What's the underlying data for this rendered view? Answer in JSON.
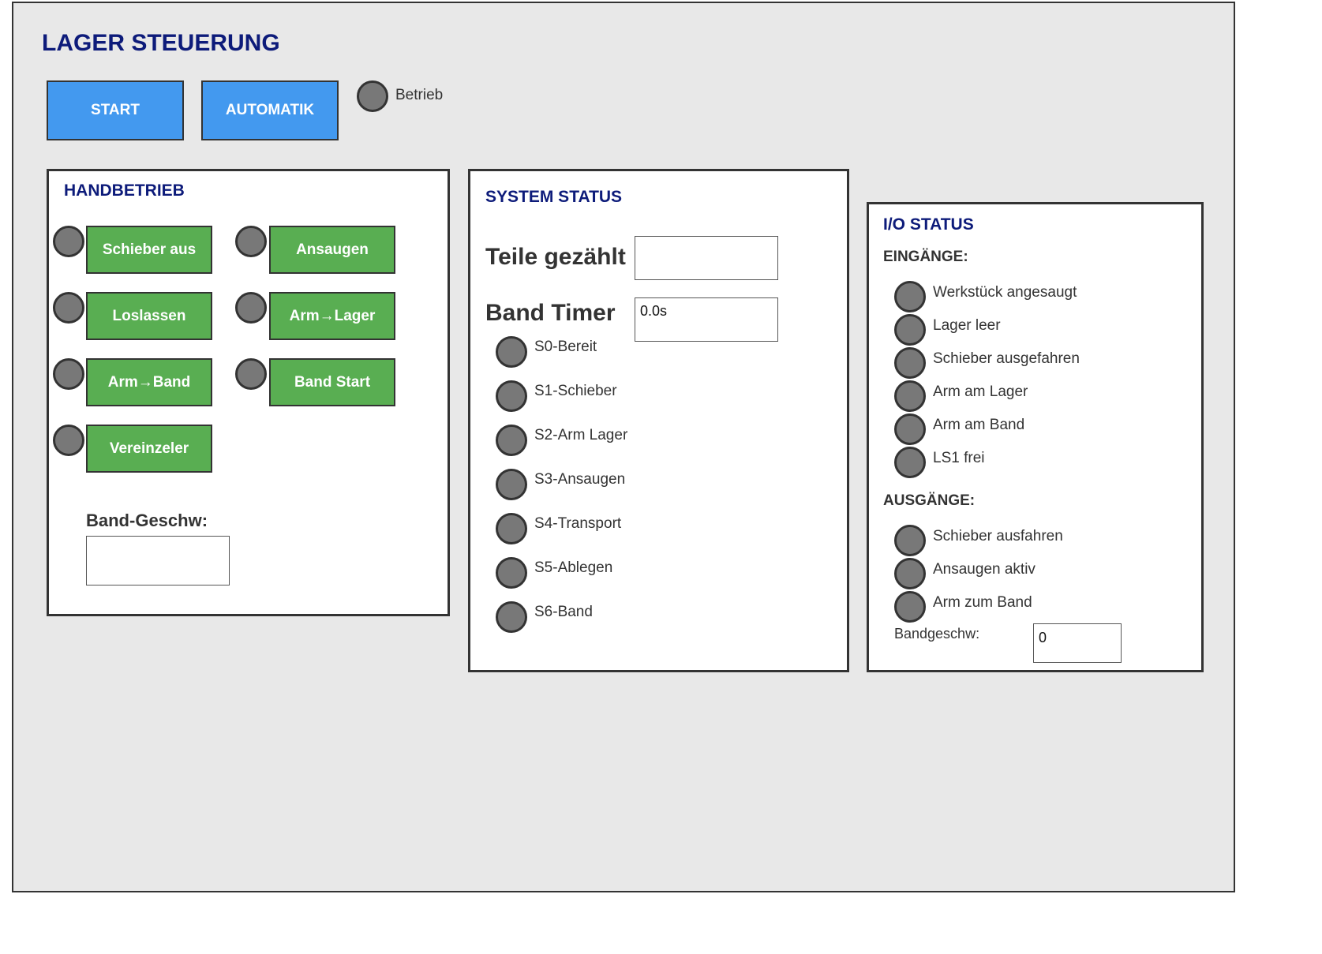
{
  "header": {
    "title": "LAGER STEUERUNG"
  },
  "controls": {
    "start_label": "START",
    "automatik_label": "AUTOMATIK",
    "betrieb_label": "Betrieb"
  },
  "handbetrieb": {
    "title": "HANDBETRIEB",
    "buttons": [
      {
        "label": "Schieber aus"
      },
      {
        "label": "Ansaugen"
      },
      {
        "label": "Loslassen"
      },
      {
        "label": "Arm→Lager"
      },
      {
        "label": "Arm→Band"
      },
      {
        "label": "Band Start"
      },
      {
        "label": "Vereinzeler"
      }
    ],
    "speed_label": "Band-Geschw:",
    "speed_value": ""
  },
  "system_status": {
    "title": "SYSTEM STATUS",
    "teile_label": "Teile gezählt",
    "teile_value": "",
    "timer_label": "Band Timer",
    "timer_value": "0.0s",
    "states": [
      {
        "label": "S0-Bereit"
      },
      {
        "label": "S1-Schieber"
      },
      {
        "label": "S2-Arm Lager"
      },
      {
        "label": "S3-Ansaugen"
      },
      {
        "label": "S4-Transport"
      },
      {
        "label": "S5-Ablegen"
      },
      {
        "label": "S6-Band"
      }
    ]
  },
  "io_status": {
    "title": "I/O STATUS",
    "inputs_title": "EINGÄNGE:",
    "inputs": [
      {
        "label": "Werkstück angesaugt"
      },
      {
        "label": "Lager leer"
      },
      {
        "label": "Schieber ausgefahren"
      },
      {
        "label": "Arm am Lager"
      },
      {
        "label": "Arm am Band"
      },
      {
        "label": "LS1 frei"
      }
    ],
    "outputs_title": "AUSGÄNGE:",
    "outputs": [
      {
        "label": "Schieber ausfahren"
      },
      {
        "label": "Ansaugen aktiv"
      },
      {
        "label": "Arm zum Band"
      }
    ],
    "speed_label": "Bandgeschw:",
    "speed_value": "0"
  },
  "colors": {
    "background": "#e8e8e8",
    "title": "#0d1b7a",
    "primary_button": "#4399ef",
    "action_button": "#59ae52",
    "led_off": "#787878"
  }
}
